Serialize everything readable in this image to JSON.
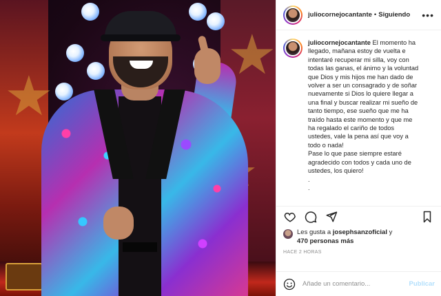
{
  "post": {
    "username": "juliocornejocantante",
    "follow_status": "Siguiendo",
    "separator": "•",
    "more_menu": "•••",
    "caption_lines": [
      "El momento ha",
      "llegado, mañana estoy de vuelta e",
      "intentaré recuperar mi silla, voy con",
      "todas las ganas, el ánimo y la voluntad",
      "que Dios y mis hijos me han dado de",
      "volver a ser un consagrado y de soñar",
      "nuevamente si Dios lo quiere llegar a",
      "una final y buscar realizar mi sueño de",
      "tanto tiempo, ese sueño que me ha",
      "traído hasta este momento y que me",
      "ha regalado el cariño de todos",
      "ustedes, vale la pena así que voy a",
      "todo o nada!",
      "Pase lo que pase siempre estaré",
      "agradecido con todos y cada uno de",
      "ustedes, los quiero!",
      ".",
      "."
    ],
    "likes": {
      "prefix": "Les gusta a",
      "user": "josephsanzoficial",
      "connector": "y",
      "count": "470 personas más"
    },
    "timestamp": "Hace 2 horas",
    "comment": {
      "placeholder": "Añade un comentario...",
      "publish_label": "Publicar"
    },
    "icons": {
      "like": "heart-icon",
      "comment": "comment-icon",
      "share": "share-icon",
      "save": "bookmark-icon",
      "emoji": "smiley-icon"
    }
  },
  "colors": {
    "text": "#262626",
    "muted": "#8e8e8e",
    "border": "#efefef",
    "publish_disabled": "#b2dffc"
  }
}
